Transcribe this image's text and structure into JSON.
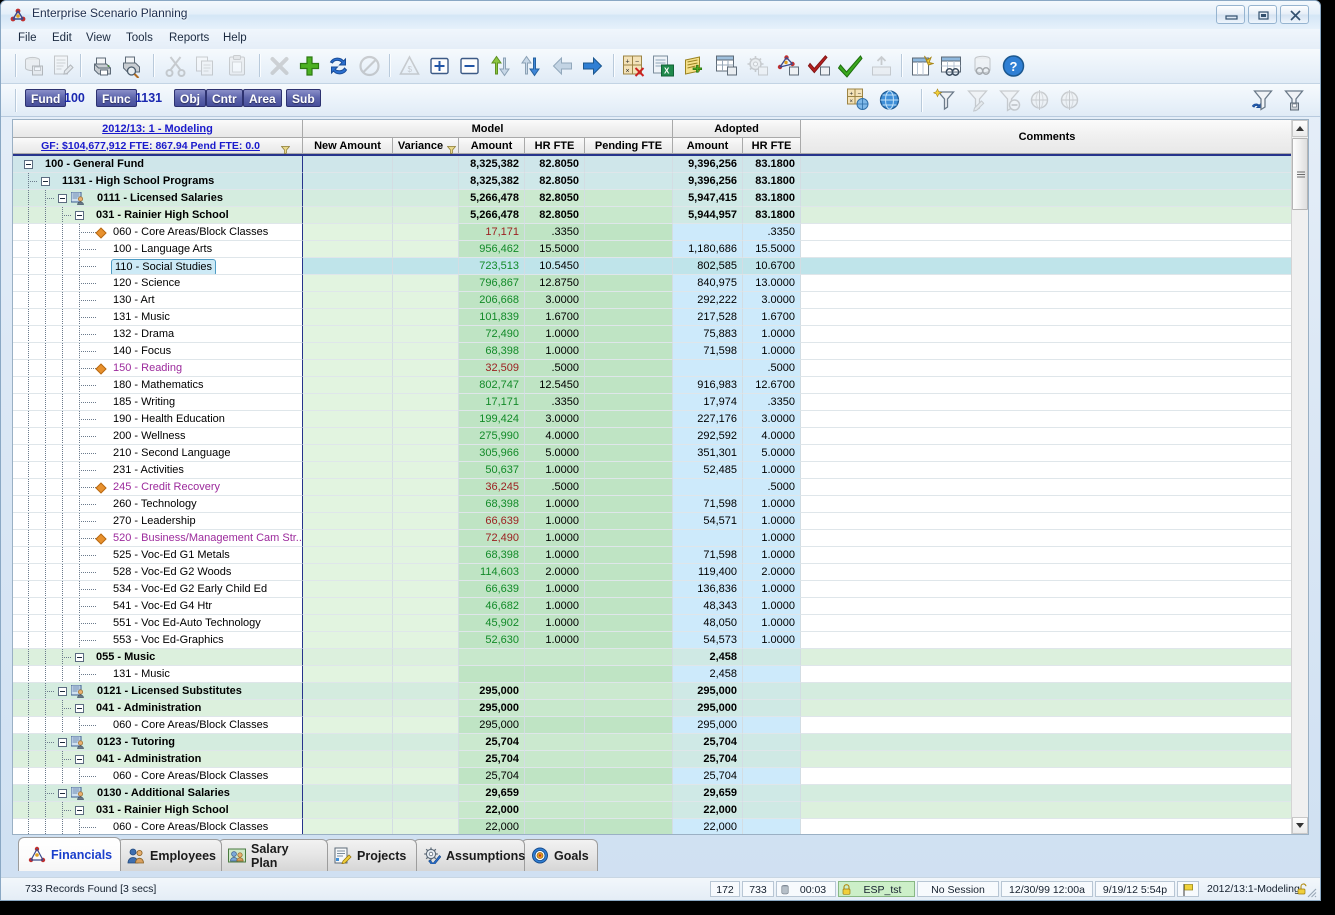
{
  "window": {
    "title": "Enterprise Scenario Planning",
    "minimize_label": "Minimize",
    "maximize_label": "Maximize",
    "close_label": "Close"
  },
  "menu": [
    "File",
    "Edit",
    "View",
    "Tools",
    "Reports",
    "Help"
  ],
  "toolbar": {
    "icons": [
      "save-icon",
      "edit-document-icon",
      "print-icon",
      "print-preview-icon",
      "cut-icon",
      "copy-icon",
      "paste-icon",
      "delete-icon",
      "add-icon",
      "refresh-icon",
      "cancel-icon",
      "drill-icon",
      "expand-icon",
      "collapse-icon",
      "move-up-icon",
      "move-down-icon",
      "back-icon",
      "forward-icon",
      "calculate-icon",
      "export-excel-icon",
      "notes-icon",
      "grid-view-icon",
      "settings-icon",
      "scenario-icon",
      "approve-red-icon",
      "approve-green-icon",
      "upload-icon",
      "report-new-icon",
      "report-find-icon",
      "database-find-icon",
      "help-icon"
    ]
  },
  "toolbar2": {
    "chips": [
      {
        "label": "Fund",
        "value": "100"
      },
      {
        "label": "Func",
        "value": "1131"
      },
      {
        "label": "Obj",
        "value": ""
      },
      {
        "label": "Cntr",
        "value": ""
      },
      {
        "label": "Area",
        "value": ""
      },
      {
        "label": "Sub",
        "value": ""
      }
    ],
    "icons": [
      "calc-fields-icon",
      "globe-target-icon",
      "new-filter-icon",
      "edit-filter-icon",
      "remove-filter-icon",
      "global-filter-icon",
      "global-filter-off-icon",
      "apply-filter-icon",
      "save-filter-icon"
    ],
    "filter_combo_value": "",
    "filter_combo_placeholder": ""
  },
  "grid": {
    "scenario_link": "2012/13: 1 - Modeling",
    "summary_link": "GF: $104,677,912  FTE: 867.94  Pend FTE: 0.0",
    "group_headers": [
      {
        "label": "Model"
      },
      {
        "label": "Adopted"
      },
      {
        "label": "Comments"
      }
    ],
    "columns": [
      "New Amount",
      "Variance",
      "Amount",
      "HR FTE",
      "Pending FTE",
      "Amount",
      "HR FTE"
    ],
    "rows": [
      {
        "level": 0,
        "expander": true,
        "icon": null,
        "marker": false,
        "label": "100 - General Fund",
        "bold": true,
        "color": "black",
        "new": "",
        "var": "",
        "amt": "8,325,382",
        "fte": "82.8050",
        "pend": "",
        "aamt": "9,396,256",
        "afte": "83.1800",
        "numcolor": "black",
        "selected": false
      },
      {
        "level": 1,
        "expander": true,
        "icon": null,
        "marker": false,
        "label": "1131 - High School Programs",
        "bold": true,
        "color": "black",
        "new": "",
        "var": "",
        "amt": "8,325,382",
        "fte": "82.8050",
        "pend": "",
        "aamt": "9,396,256",
        "afte": "83.1800",
        "numcolor": "green",
        "selected": false
      },
      {
        "level": 2,
        "expander": true,
        "icon": "people-icon",
        "marker": false,
        "label": "0111 -  Licensed Salaries",
        "bold": true,
        "color": "black",
        "new": "",
        "var": "",
        "amt": "5,266,478",
        "fte": "82.8050",
        "pend": "",
        "aamt": "5,947,415",
        "afte": "83.1800",
        "numcolor": "green",
        "selected": false
      },
      {
        "level": 3,
        "expander": true,
        "icon": null,
        "marker": false,
        "label": "031 - Rainier High School",
        "bold": true,
        "color": "black",
        "new": "",
        "var": "",
        "amt": "5,266,478",
        "fte": "82.8050",
        "pend": "",
        "aamt": "5,944,957",
        "afte": "83.1800",
        "numcolor": "green",
        "selected": false
      },
      {
        "level": 4,
        "expander": false,
        "icon": null,
        "marker": true,
        "label": "060 - Core Areas/Block Classes",
        "bold": false,
        "color": "black",
        "new": "",
        "var": "",
        "amt": "17,171",
        "fte": ".3350",
        "pend": "",
        "aamt": "",
        "afte": ".3350",
        "numcolor": "red",
        "selected": false
      },
      {
        "level": 4,
        "expander": false,
        "icon": null,
        "marker": false,
        "label": "100 - Language Arts",
        "bold": false,
        "color": "black",
        "new": "",
        "var": "",
        "amt": "956,462",
        "fte": "15.5000",
        "pend": "",
        "aamt": "1,180,686",
        "afte": "15.5000",
        "numcolor": "green",
        "selected": false
      },
      {
        "level": 4,
        "expander": false,
        "icon": null,
        "marker": false,
        "label": "110 - Social Studies",
        "bold": false,
        "color": "black",
        "new": "",
        "var": "",
        "amt": "723,513",
        "fte": "10.5450",
        "pend": "",
        "aamt": "802,585",
        "afte": "10.6700",
        "numcolor": "green",
        "selected": true
      },
      {
        "level": 4,
        "expander": false,
        "icon": null,
        "marker": false,
        "label": "120 - Science",
        "bold": false,
        "color": "black",
        "new": "",
        "var": "",
        "amt": "796,867",
        "fte": "12.8750",
        "pend": "",
        "aamt": "840,975",
        "afte": "13.0000",
        "numcolor": "green",
        "selected": false
      },
      {
        "level": 4,
        "expander": false,
        "icon": null,
        "marker": false,
        "label": "130 - Art",
        "bold": false,
        "color": "black",
        "new": "",
        "var": "",
        "amt": "206,668",
        "fte": "3.0000",
        "pend": "",
        "aamt": "292,222",
        "afte": "3.0000",
        "numcolor": "green",
        "selected": false
      },
      {
        "level": 4,
        "expander": false,
        "icon": null,
        "marker": false,
        "label": "131 - Music",
        "bold": false,
        "color": "black",
        "new": "",
        "var": "",
        "amt": "101,839",
        "fte": "1.6700",
        "pend": "",
        "aamt": "217,528",
        "afte": "1.6700",
        "numcolor": "green",
        "selected": false
      },
      {
        "level": 4,
        "expander": false,
        "icon": null,
        "marker": false,
        "label": "132 - Drama",
        "bold": false,
        "color": "black",
        "new": "",
        "var": "",
        "amt": "72,490",
        "fte": "1.0000",
        "pend": "",
        "aamt": "75,883",
        "afte": "1.0000",
        "numcolor": "green",
        "selected": false
      },
      {
        "level": 4,
        "expander": false,
        "icon": null,
        "marker": false,
        "label": "140 - Focus",
        "bold": false,
        "color": "black",
        "new": "",
        "var": "",
        "amt": "68,398",
        "fte": "1.0000",
        "pend": "",
        "aamt": "71,598",
        "afte": "1.0000",
        "numcolor": "green",
        "selected": false
      },
      {
        "level": 4,
        "expander": false,
        "icon": null,
        "marker": true,
        "label": "150 - Reading",
        "bold": false,
        "color": "purple",
        "new": "",
        "var": "",
        "amt": "32,509",
        "fte": ".5000",
        "pend": "",
        "aamt": "",
        "afte": ".5000",
        "numcolor": "red",
        "selected": false
      },
      {
        "level": 4,
        "expander": false,
        "icon": null,
        "marker": false,
        "label": "180 - Mathematics",
        "bold": false,
        "color": "black",
        "new": "",
        "var": "",
        "amt": "802,747",
        "fte": "12.5450",
        "pend": "",
        "aamt": "916,983",
        "afte": "12.6700",
        "numcolor": "green",
        "selected": false
      },
      {
        "level": 4,
        "expander": false,
        "icon": null,
        "marker": false,
        "label": "185 - Writing",
        "bold": false,
        "color": "black",
        "new": "",
        "var": "",
        "amt": "17,171",
        "fte": ".3350",
        "pend": "",
        "aamt": "17,974",
        "afte": ".3350",
        "numcolor": "green",
        "selected": false
      },
      {
        "level": 4,
        "expander": false,
        "icon": null,
        "marker": false,
        "label": "190 - Health Education",
        "bold": false,
        "color": "black",
        "new": "",
        "var": "",
        "amt": "199,424",
        "fte": "3.0000",
        "pend": "",
        "aamt": "227,176",
        "afte": "3.0000",
        "numcolor": "green",
        "selected": false
      },
      {
        "level": 4,
        "expander": false,
        "icon": null,
        "marker": false,
        "label": "200 - Wellness",
        "bold": false,
        "color": "black",
        "new": "",
        "var": "",
        "amt": "275,990",
        "fte": "4.0000",
        "pend": "",
        "aamt": "292,592",
        "afte": "4.0000",
        "numcolor": "green",
        "selected": false
      },
      {
        "level": 4,
        "expander": false,
        "icon": null,
        "marker": false,
        "label": "210 - Second Language",
        "bold": false,
        "color": "black",
        "new": "",
        "var": "",
        "amt": "305,966",
        "fte": "5.0000",
        "pend": "",
        "aamt": "351,301",
        "afte": "5.0000",
        "numcolor": "green",
        "selected": false
      },
      {
        "level": 4,
        "expander": false,
        "icon": null,
        "marker": false,
        "label": "231 - Activities",
        "bold": false,
        "color": "black",
        "new": "",
        "var": "",
        "amt": "50,637",
        "fte": "1.0000",
        "pend": "",
        "aamt": "52,485",
        "afte": "1.0000",
        "numcolor": "green",
        "selected": false
      },
      {
        "level": 4,
        "expander": false,
        "icon": null,
        "marker": true,
        "label": "245 - Credit Recovery",
        "bold": false,
        "color": "purple",
        "new": "",
        "var": "",
        "amt": "36,245",
        "fte": ".5000",
        "pend": "",
        "aamt": "",
        "afte": ".5000",
        "numcolor": "red",
        "selected": false
      },
      {
        "level": 4,
        "expander": false,
        "icon": null,
        "marker": false,
        "label": "260 - Technology",
        "bold": false,
        "color": "black",
        "new": "",
        "var": "",
        "amt": "68,398",
        "fte": "1.0000",
        "pend": "",
        "aamt": "71,598",
        "afte": "1.0000",
        "numcolor": "green",
        "selected": false
      },
      {
        "level": 4,
        "expander": false,
        "icon": null,
        "marker": false,
        "label": "270 - Leadership",
        "bold": false,
        "color": "black",
        "new": "",
        "var": "",
        "amt": "66,639",
        "fte": "1.0000",
        "pend": "",
        "aamt": "54,571",
        "afte": "1.0000",
        "numcolor": "red",
        "selected": false
      },
      {
        "level": 4,
        "expander": false,
        "icon": null,
        "marker": true,
        "label": "520 - Business/Management Cam Str...",
        "bold": false,
        "color": "purple",
        "new": "",
        "var": "",
        "amt": "72,490",
        "fte": "1.0000",
        "pend": "",
        "aamt": "",
        "afte": "1.0000",
        "numcolor": "red",
        "selected": false
      },
      {
        "level": 4,
        "expander": false,
        "icon": null,
        "marker": false,
        "label": "525 - Voc-Ed G1 Metals",
        "bold": false,
        "color": "black",
        "new": "",
        "var": "",
        "amt": "68,398",
        "fte": "1.0000",
        "pend": "",
        "aamt": "71,598",
        "afte": "1.0000",
        "numcolor": "green",
        "selected": false
      },
      {
        "level": 4,
        "expander": false,
        "icon": null,
        "marker": false,
        "label": "528 - Voc-Ed G2 Woods",
        "bold": false,
        "color": "black",
        "new": "",
        "var": "",
        "amt": "114,603",
        "fte": "2.0000",
        "pend": "",
        "aamt": "119,400",
        "afte": "2.0000",
        "numcolor": "green",
        "selected": false
      },
      {
        "level": 4,
        "expander": false,
        "icon": null,
        "marker": false,
        "label": "534 - Voc-Ed G2 Early Child Ed",
        "bold": false,
        "color": "black",
        "new": "",
        "var": "",
        "amt": "66,639",
        "fte": "1.0000",
        "pend": "",
        "aamt": "136,836",
        "afte": "1.0000",
        "numcolor": "green",
        "selected": false
      },
      {
        "level": 4,
        "expander": false,
        "icon": null,
        "marker": false,
        "label": "541 - Voc-Ed G4 Htr",
        "bold": false,
        "color": "black",
        "new": "",
        "var": "",
        "amt": "46,682",
        "fte": "1.0000",
        "pend": "",
        "aamt": "48,343",
        "afte": "1.0000",
        "numcolor": "green",
        "selected": false
      },
      {
        "level": 4,
        "expander": false,
        "icon": null,
        "marker": false,
        "label": "551 - Voc Ed-Auto Technology",
        "bold": false,
        "color": "black",
        "new": "",
        "var": "",
        "amt": "45,902",
        "fte": "1.0000",
        "pend": "",
        "aamt": "48,050",
        "afte": "1.0000",
        "numcolor": "green",
        "selected": false
      },
      {
        "level": 4,
        "expander": false,
        "icon": null,
        "marker": false,
        "label": "553 - Voc Ed-Graphics",
        "bold": false,
        "color": "black",
        "new": "",
        "var": "",
        "amt": "52,630",
        "fte": "1.0000",
        "pend": "",
        "aamt": "54,573",
        "afte": "1.0000",
        "numcolor": "green",
        "selected": false
      },
      {
        "level": 3,
        "expander": true,
        "icon": null,
        "marker": false,
        "label": "055 - Music",
        "bold": true,
        "color": "black",
        "new": "",
        "var": "",
        "amt": "",
        "fte": "",
        "pend": "",
        "aamt": "2,458",
        "afte": "",
        "numcolor": "black",
        "selected": false
      },
      {
        "level": 4,
        "expander": false,
        "icon": null,
        "marker": false,
        "label": "131 - Music",
        "bold": false,
        "color": "black",
        "new": "",
        "var": "",
        "amt": "",
        "fte": "",
        "pend": "",
        "aamt": "2,458",
        "afte": "",
        "numcolor": "black",
        "selected": false
      },
      {
        "level": 2,
        "expander": true,
        "icon": "people-icon",
        "marker": false,
        "label": "0121 -  Licensed Substitutes",
        "bold": true,
        "color": "black",
        "new": "",
        "var": "",
        "amt": "295,000",
        "fte": "",
        "pend": "",
        "aamt": "295,000",
        "afte": "",
        "numcolor": "black",
        "selected": false
      },
      {
        "level": 3,
        "expander": true,
        "icon": null,
        "marker": false,
        "label": "041 - Administration",
        "bold": true,
        "color": "black",
        "new": "",
        "var": "",
        "amt": "295,000",
        "fte": "",
        "pend": "",
        "aamt": "295,000",
        "afte": "",
        "numcolor": "black",
        "selected": false
      },
      {
        "level": 4,
        "expander": false,
        "icon": null,
        "marker": false,
        "label": "060 - Core Areas/Block Classes",
        "bold": false,
        "color": "black",
        "new": "",
        "var": "",
        "amt": "295,000",
        "fte": "",
        "pend": "",
        "aamt": "295,000",
        "afte": "",
        "numcolor": "black",
        "selected": false
      },
      {
        "level": 2,
        "expander": true,
        "icon": "people-icon",
        "marker": false,
        "label": "0123 -  Tutoring",
        "bold": true,
        "color": "black",
        "new": "",
        "var": "",
        "amt": "25,704",
        "fte": "",
        "pend": "",
        "aamt": "25,704",
        "afte": "",
        "numcolor": "black",
        "selected": false
      },
      {
        "level": 3,
        "expander": true,
        "icon": null,
        "marker": false,
        "label": "041 - Administration",
        "bold": true,
        "color": "black",
        "new": "",
        "var": "",
        "amt": "25,704",
        "fte": "",
        "pend": "",
        "aamt": "25,704",
        "afte": "",
        "numcolor": "black",
        "selected": false
      },
      {
        "level": 4,
        "expander": false,
        "icon": null,
        "marker": false,
        "label": "060 - Core Areas/Block Classes",
        "bold": false,
        "color": "black",
        "new": "",
        "var": "",
        "amt": "25,704",
        "fte": "",
        "pend": "",
        "aamt": "25,704",
        "afte": "",
        "numcolor": "black",
        "selected": false
      },
      {
        "level": 2,
        "expander": true,
        "icon": "people-icon",
        "marker": false,
        "label": "0130 -  Additional Salaries",
        "bold": true,
        "color": "black",
        "new": "",
        "var": "",
        "amt": "29,659",
        "fte": "",
        "pend": "",
        "aamt": "29,659",
        "afte": "",
        "numcolor": "black",
        "selected": false
      },
      {
        "level": 3,
        "expander": true,
        "icon": null,
        "marker": false,
        "label": "031 - Rainier High School",
        "bold": true,
        "color": "black",
        "new": "",
        "var": "",
        "amt": "22,000",
        "fte": "",
        "pend": "",
        "aamt": "22,000",
        "afte": "",
        "numcolor": "black",
        "selected": false
      },
      {
        "level": 4,
        "expander": false,
        "icon": null,
        "marker": false,
        "label": "060 - Core Areas/Block Classes",
        "bold": false,
        "color": "black",
        "new": "",
        "var": "",
        "amt": "22,000",
        "fte": "",
        "pend": "",
        "aamt": "22,000",
        "afte": "",
        "numcolor": "black",
        "selected": false
      }
    ]
  },
  "tabs": [
    {
      "label": "Financials",
      "icon": "network-nodes-icon",
      "active": true
    },
    {
      "label": "Employees",
      "icon": "people-icon",
      "active": false
    },
    {
      "label": "Salary Plan",
      "icon": "money-people-icon",
      "active": false
    },
    {
      "label": "Projects",
      "icon": "project-doc-icon",
      "active": false
    },
    {
      "label": "Assumptions",
      "icon": "gear-check-icon",
      "active": false
    },
    {
      "label": "Goals",
      "icon": "target-icon",
      "active": false
    }
  ],
  "statusbar": {
    "records_found": "733  Records Found [3 secs]",
    "count1": "172",
    "count2": "733",
    "disk_icon": "database-icon",
    "elapsed": "00:03",
    "lock_icon": "lock-icon",
    "connection": "ESP_tst",
    "session": "No Session",
    "date1": "12/30/99 12:00a",
    "date2": "9/19/12 5:54p",
    "flag_icon": "flag-icon",
    "scenario": "2012/13:1-Modeling",
    "unlock_icon": "unlock-icon"
  },
  "colors": {
    "accent": "#26348c",
    "model_amount_green": "#128a28",
    "variance_red": "#9c2020",
    "marker_purple": "#9c2a9c",
    "selection": "#cdeaf6"
  }
}
